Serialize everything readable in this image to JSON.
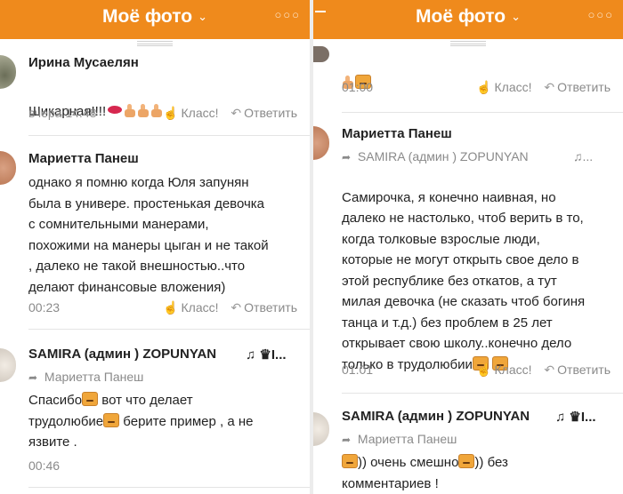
{
  "left_panel": {
    "header": {
      "title": "Моё фото",
      "chevron": "⌄",
      "menu": "○○○"
    },
    "comments": [
      {
        "author": "Ирина Мусаелян",
        "text": "Шикарная!!!!",
        "time": "вчера 14:48",
        "like_label": "Класс!",
        "reply_label": "Ответить"
      },
      {
        "author": "Мариетта Панеш",
        "text": "однако я помню когда Юля запунян\nбыла в универе. простенькая девочка\nс сомнительными манерами,\nпохожими на манеры цыган и не такой\n, далеко не такой внешностью..что\nделают финансовые вложения)",
        "time": "00:23",
        "like_label": "Класс!",
        "reply_label": "Ответить"
      },
      {
        "author": "SAMIRA (админ ) ZOPUNYAN",
        "badge": "♫ ♛I...",
        "reply_to": "Мариетта Панеш",
        "text_1": "Спасибо",
        "text_2": " вот что  делает",
        "text_3": "трудолюбие",
        "text_4": " берите пример , а не",
        "text_5": "язвите .",
        "time": "00:46"
      }
    ]
  },
  "right_panel": {
    "header": {
      "title": "Моё фото",
      "chevron": "⌄",
      "menu": "○○○"
    },
    "comments": [
      {
        "time": "01:00",
        "like_label": "Класс!",
        "reply_label": "Ответить"
      },
      {
        "author": "Мариетта Панеш",
        "reply_to": "SAMIRA (админ ) ZOPUNYAN",
        "reply_badge": "♫...",
        "text": "Самирочка, я конечно наивная, но\nдалеко не настолько, чтоб верить в то,\nкогда толковые взрослые люди,\nкоторые не могут открыть свое дело в\nэтой республике без откатов, а тут\nмилая девочка (не сказать чтоб богиня\nтанца и т.д.) без проблем в 25 лет\nоткрывает свою школу..конечно дело\nтолько в трудолюбии",
        "time": "01:01",
        "like_label": "Класс!",
        "reply_label": "Ответить"
      },
      {
        "author": "SAMIRA (админ ) ZOPUNYAN",
        "badge": "♫ ♛I...",
        "reply_to": "Мариетта Панеш",
        "text_1": ")) очень смешно",
        "text_2": ")) без",
        "text_3": "комментариев !"
      }
    ]
  },
  "icons": {
    "like": "thumb-up-icon",
    "reply": "reply-arrow-icon",
    "emoji": "laughing-emoji-icon"
  },
  "colors": {
    "header_bg": "#ef8a1c",
    "meta_text": "#8a8a8a"
  }
}
